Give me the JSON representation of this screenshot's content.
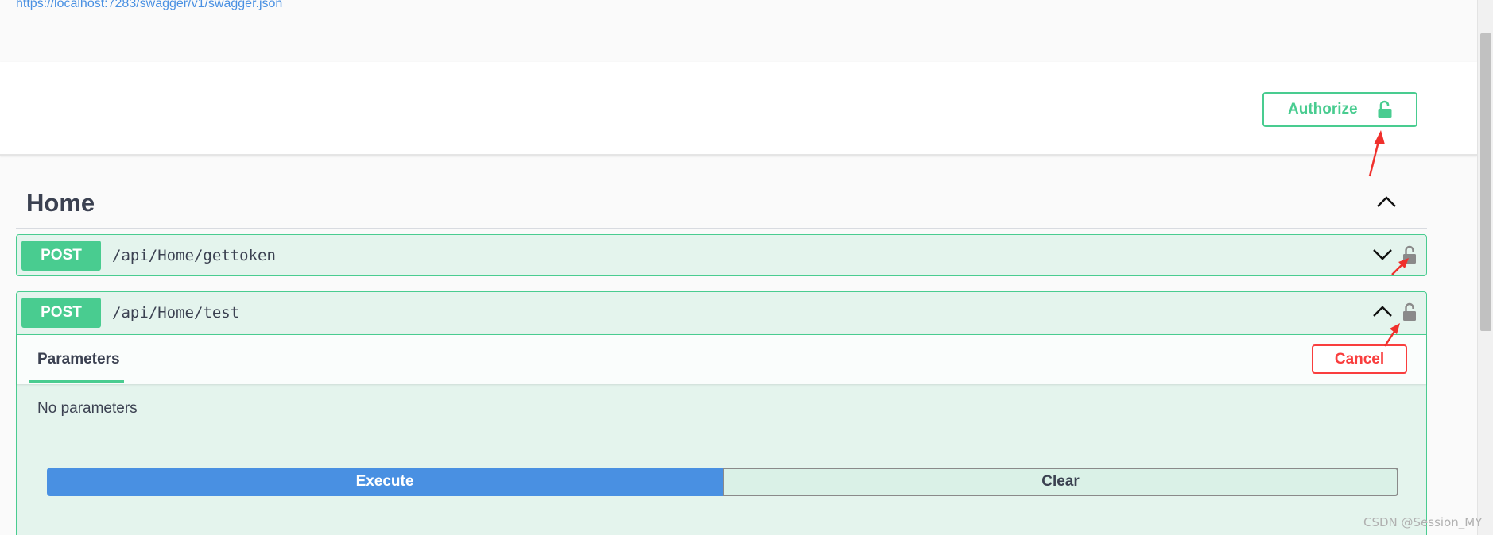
{
  "info": {
    "spec_url": "https://localhost:7283/swagger/v1/swagger.json"
  },
  "auth": {
    "authorize_label": "Authorize",
    "lock_icon": "lock-open-icon"
  },
  "tag": {
    "name": "Home",
    "toggle_icon": "chevron-up-icon"
  },
  "operations": [
    {
      "method": "POST",
      "path": "/api/Home/gettoken",
      "chevron_icon": "chevron-down-icon",
      "lock_icon": "lock-open-icon",
      "expanded": false
    },
    {
      "method": "POST",
      "path": "/api/Home/test",
      "chevron_icon": "chevron-up-icon",
      "lock_icon": "lock-open-icon",
      "expanded": true,
      "tab_label": "Parameters",
      "cancel_label": "Cancel",
      "no_params_text": "No parameters",
      "execute_label": "Execute",
      "clear_label": "Clear"
    }
  ],
  "watermark": "CSDN @Session_MY",
  "colors": {
    "post_green": "#49cc90",
    "execute_blue": "#4990e2",
    "cancel_red": "#f93e3e",
    "annotation_red": "#f0302c"
  }
}
